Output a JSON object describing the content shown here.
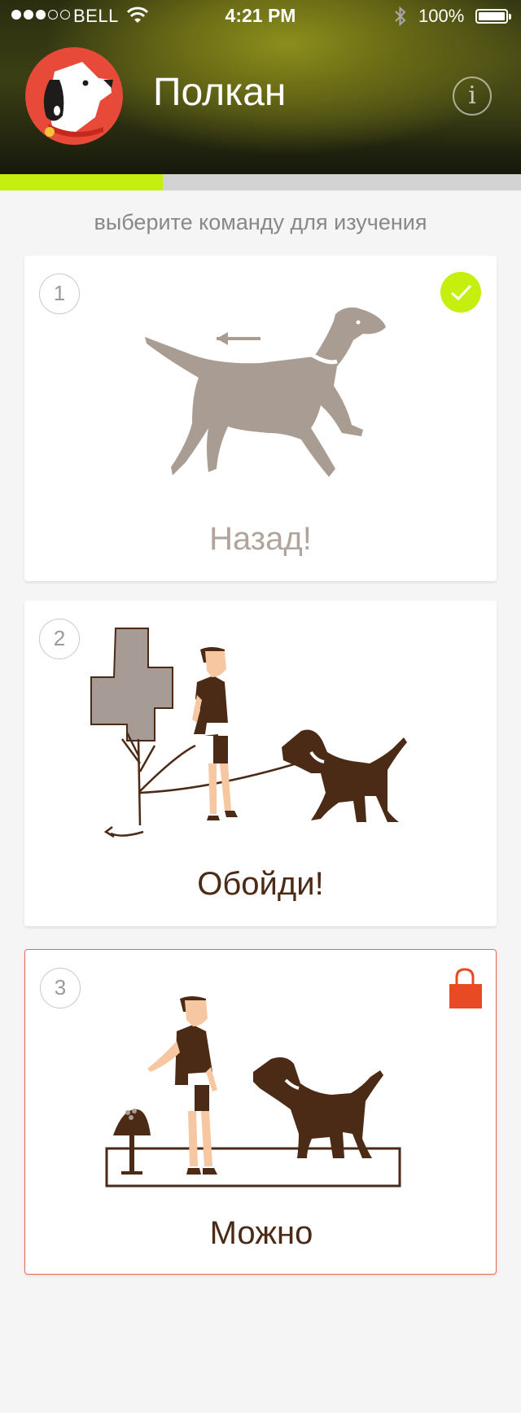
{
  "status_bar": {
    "carrier": "BELL",
    "time": "4:21 PM",
    "battery": "100%",
    "signal_full": 3,
    "signal_empty": 2
  },
  "header": {
    "dog_name": "Полкан",
    "info_icon": "info-icon",
    "info_label": "i",
    "avatar_icon": "dog-face-icon"
  },
  "progress": {
    "fraction": 0.3125,
    "color": "#c5ef0f"
  },
  "subtitle": "выберите команду для изучения",
  "commands": [
    {
      "number": "1",
      "title": "Назад!",
      "state": "completed",
      "badge_icon": "check-icon"
    },
    {
      "number": "2",
      "title": "Обойди!",
      "state": "active",
      "badge_icon": ""
    },
    {
      "number": "3",
      "title": "Можно",
      "state": "locked",
      "badge_icon": "lock-icon"
    }
  ],
  "colors": {
    "accent": "#c5ef0f",
    "lock": "#e84a24",
    "brown": "#4b2a16",
    "completed_gray": "#b0a59c"
  }
}
